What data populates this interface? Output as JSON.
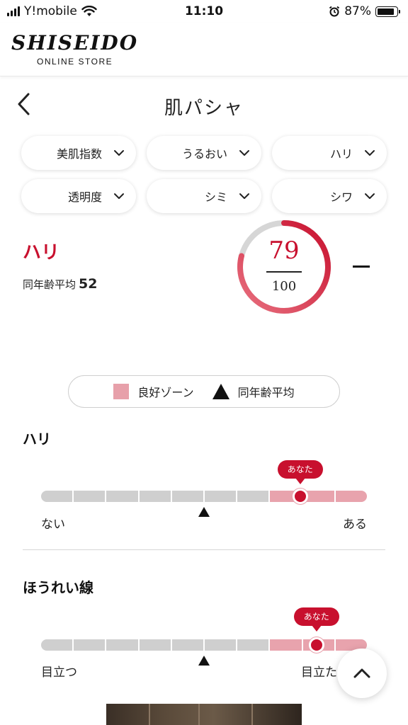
{
  "status_bar": {
    "carrier": "Y!mobile",
    "time": "11:10",
    "battery": "87%",
    "battery_level": 0.87
  },
  "header": {
    "brand": "SHISEIDO",
    "subtitle": "ONLINE STORE"
  },
  "page": {
    "title": "肌パシャ",
    "back_icon": "chevron-left-icon"
  },
  "filters": [
    {
      "label": "美肌指数"
    },
    {
      "label": "うるおい"
    },
    {
      "label": "ハリ"
    },
    {
      "label": "透明度"
    },
    {
      "label": "シミ"
    },
    {
      "label": "シワ"
    }
  ],
  "score_card": {
    "metric": "ハリ",
    "avg_label": "同年齢平均",
    "avg_value": "52",
    "score": "79",
    "max": "100",
    "score_fraction": 0.79
  },
  "legend": {
    "good_zone": "良好ゾーン",
    "age_average": "同年齢平均"
  },
  "sections": [
    {
      "title": "ハリ",
      "bubble": "あなた",
      "low_label": "ない",
      "high_label": "ある",
      "your_position": 0.795,
      "average_position": 0.5
    },
    {
      "title": "ほうれい線",
      "bubble": "あなた",
      "low_label": "目立つ",
      "high_label": "目立たない",
      "your_position": 0.845,
      "average_position": 0.5
    }
  ],
  "colors": {
    "accent": "#c8102e",
    "good_zone": "#e8a3ad",
    "track": "#cfcfcf"
  }
}
